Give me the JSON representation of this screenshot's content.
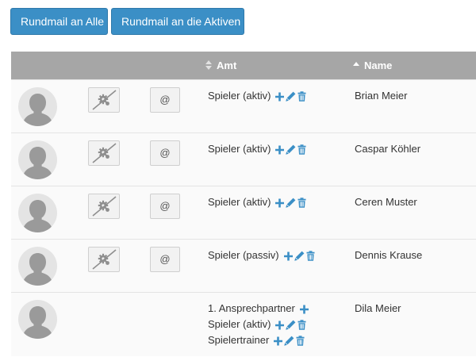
{
  "toolbar": {
    "mail_all_label": "Rundmail an Alle",
    "mail_active_label": "Rundmail an die Aktiven"
  },
  "table": {
    "columns": [
      "",
      "",
      "",
      "Amt",
      "Name"
    ],
    "sort_column": "Name",
    "sort_direction": "ascending",
    "rows": [
      {
        "name": "Brian Meier",
        "has_photo_button": true,
        "has_mail_button": true,
        "mail_label": "@",
        "roles": [
          {
            "label": "Spieler (aktiv)",
            "actions": [
              "add",
              "edit",
              "delete"
            ]
          }
        ]
      },
      {
        "name": "Caspar Köhler",
        "has_photo_button": true,
        "has_mail_button": true,
        "mail_label": "@",
        "roles": [
          {
            "label": "Spieler (aktiv)",
            "actions": [
              "add",
              "edit",
              "delete"
            ]
          }
        ]
      },
      {
        "name": "Ceren Muster",
        "has_photo_button": true,
        "has_mail_button": true,
        "mail_label": "@",
        "roles": [
          {
            "label": "Spieler (aktiv)",
            "actions": [
              "add",
              "edit",
              "delete"
            ]
          }
        ]
      },
      {
        "name": "Dennis Krause",
        "has_photo_button": true,
        "has_mail_button": true,
        "mail_label": "@",
        "roles": [
          {
            "label": "Spieler (passiv)",
            "actions": [
              "add",
              "edit",
              "delete"
            ]
          }
        ]
      },
      {
        "name": "Dila Meier",
        "has_photo_button": false,
        "has_mail_button": false,
        "roles": [
          {
            "label": "1. Ansprechpartner",
            "actions": [
              "add"
            ]
          },
          {
            "label": "Spieler (aktiv)",
            "actions": [
              "add",
              "edit",
              "delete"
            ]
          },
          {
            "label": "Spielertrainer",
            "actions": [
              "add",
              "edit",
              "delete"
            ]
          }
        ]
      }
    ]
  },
  "icons": {
    "avatar": "person-silhouette-icon",
    "photo_button": "no-photo-gear-icon",
    "add": "plus-icon",
    "edit": "pencil-icon",
    "delete": "trash-icon"
  },
  "colors": {
    "button": "#3b8fc6",
    "header": "#a6a6a6",
    "action_icon": "#3b8fc6",
    "avatar": "#9a9a9a"
  }
}
